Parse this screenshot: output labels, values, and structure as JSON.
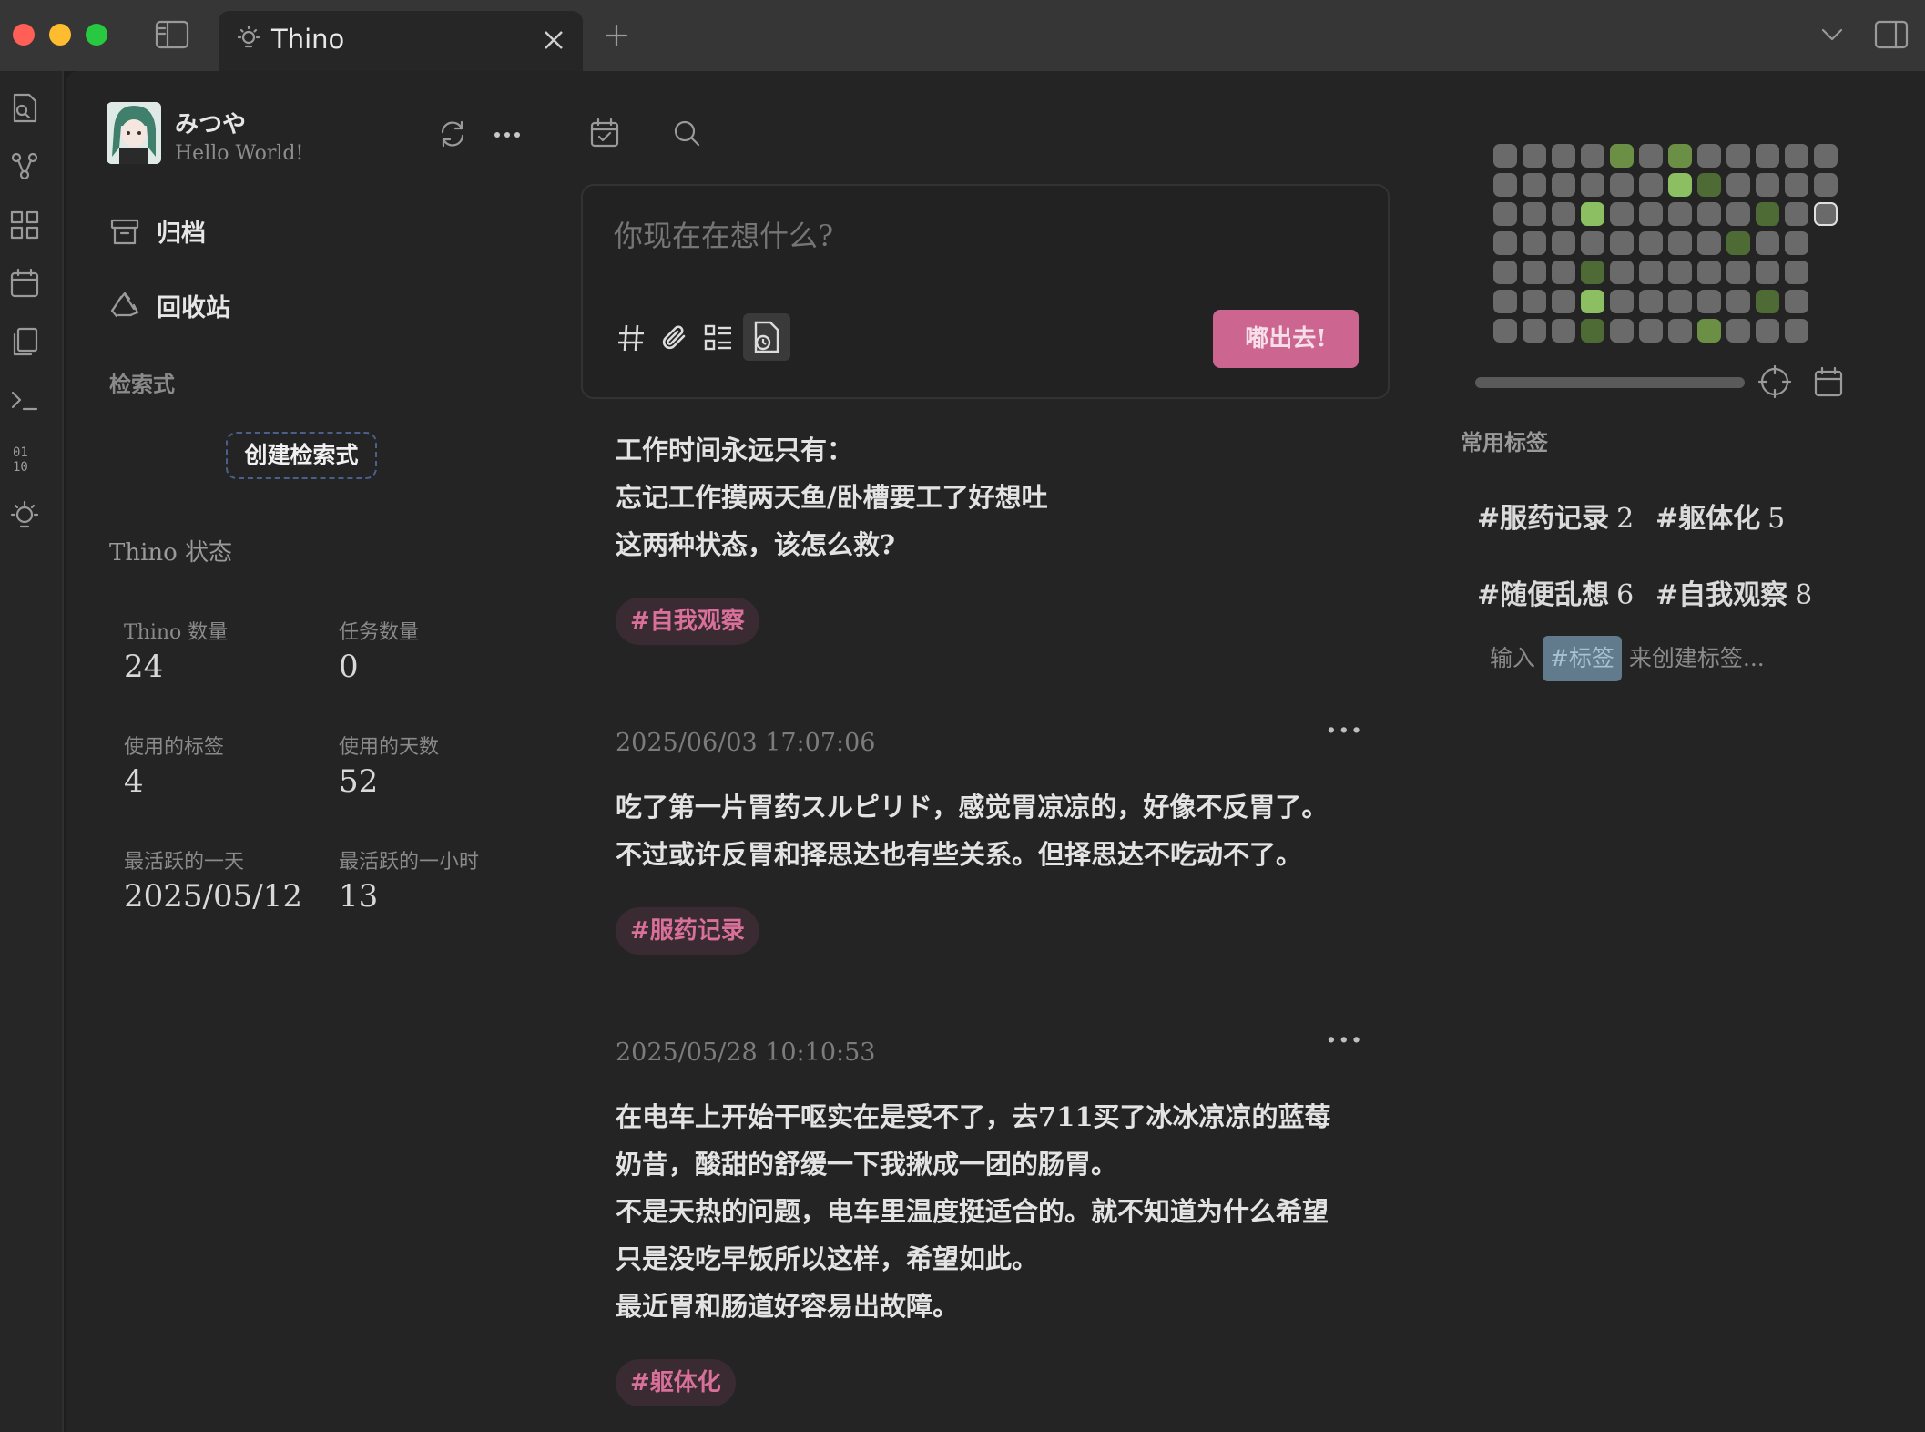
{
  "tab": {
    "title": "Thino"
  },
  "user": {
    "name": "みつや",
    "slogan": "Hello World!"
  },
  "sidebar": {
    "nav": [
      {
        "label": "归档"
      },
      {
        "label": "回收站"
      }
    ],
    "search_section_label": "检索式",
    "create_query_button": "创建检索式",
    "status_title": "Thino 状态",
    "stats": [
      {
        "label": "Thino 数量",
        "value": "24"
      },
      {
        "label": "任务数量",
        "value": "0"
      },
      {
        "label": "使用的标签",
        "value": "4"
      },
      {
        "label": "使用的天数",
        "value": "52"
      },
      {
        "label": "最活跃的一天",
        "value": "2025/05/12"
      },
      {
        "label": "最活跃的一小时",
        "value": "13"
      }
    ]
  },
  "editor": {
    "placeholder": "你现在在想什么?",
    "send_label": "嘟出去!"
  },
  "memos": [
    {
      "time": "",
      "text": "工作时间永远只有：\n忘记工作摸两天鱼/卧槽要工了好想吐\n这两种状态，该怎么救?",
      "tag": "#自我观察"
    },
    {
      "time": "2025/06/03 17:07:06",
      "text": "吃了第一片胃药スルピリド，感觉胃凉凉的，好像不反胃了。\n不过或许反胃和择思达也有些关系。但择思达不吃动不了。",
      "tag": "#服药记录"
    },
    {
      "time": "2025/05/28 10:10:53",
      "text": "在电车上开始干呕实在是受不了，去711买了冰冰凉凉的蓝莓\n奶昔，酸甜的舒缓一下我揪成一团的肠胃。\n不是天热的问题，电车里温度挺适合的。就不知道为什么希望\n只是没吃早饭所以这样，希望如此。\n最近胃和肠道好容易出故障。",
      "tag": "#躯体化"
    }
  ],
  "heatmap": {
    "rows": [
      [
        0,
        0,
        0,
        0,
        2,
        0,
        2,
        0,
        0,
        0,
        0,
        0
      ],
      [
        0,
        0,
        0,
        0,
        0,
        0,
        3,
        1,
        0,
        0,
        0,
        0
      ],
      [
        0,
        0,
        0,
        3,
        0,
        0,
        0,
        0,
        0,
        1,
        0,
        -1
      ],
      [
        0,
        0,
        0,
        0,
        0,
        0,
        0,
        0,
        1,
        0,
        0,
        null
      ],
      [
        0,
        0,
        0,
        1,
        0,
        0,
        0,
        0,
        0,
        0,
        0,
        null
      ],
      [
        0,
        0,
        0,
        3,
        0,
        0,
        0,
        0,
        0,
        1,
        0,
        null
      ],
      [
        0,
        0,
        0,
        1,
        0,
        0,
        0,
        2,
        0,
        0,
        0,
        null
      ]
    ]
  },
  "tags_panel": {
    "title": "常用标签",
    "tags": [
      {
        "name": "#服药记录",
        "count": "2"
      },
      {
        "name": "#躯体化",
        "count": "5"
      },
      {
        "name": "#随便乱想",
        "count": "6"
      },
      {
        "name": "#自我观察",
        "count": "8"
      }
    ],
    "hint_prefix": "输入",
    "hint_tag": "#标签",
    "hint_suffix": "来创建标签..."
  },
  "colors": {
    "accent": "#cc6690",
    "tag_text": "#d8709a",
    "heat_l1": "#4f6b35",
    "heat_l2": "#6b8f45",
    "heat_l3": "#8cbf62"
  }
}
